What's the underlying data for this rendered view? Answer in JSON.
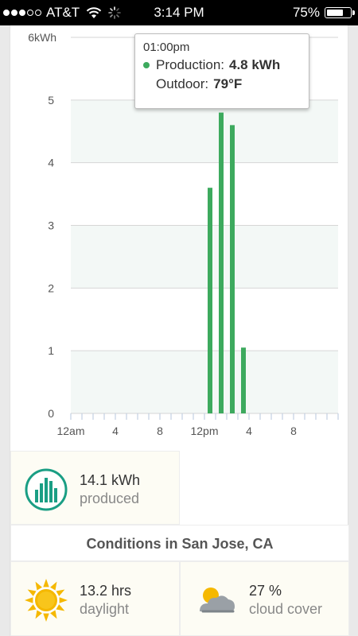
{
  "status_bar": {
    "carrier": "AT&T",
    "time": "3:14 PM",
    "battery_percent": "75%",
    "battery_level": 0.75,
    "signal_bars_filled": 3,
    "signal_bars_total": 5
  },
  "chart_data": {
    "type": "bar",
    "ylabel": "",
    "xlabel": "",
    "ylim": [
      0,
      6
    ],
    "y_ticks": [
      "0",
      "1",
      "2",
      "3",
      "4",
      "5",
      "6kWh"
    ],
    "x_tick_labels": [
      "12am",
      "4",
      "8",
      "12pm",
      "4",
      "8"
    ],
    "hours": [
      0,
      1,
      2,
      3,
      4,
      5,
      6,
      7,
      8,
      9,
      10,
      11,
      12,
      13,
      14,
      15,
      16,
      17,
      18,
      19,
      20,
      21,
      22,
      23
    ],
    "values": [
      0,
      0,
      0,
      0,
      0,
      0,
      0,
      0,
      0,
      0,
      0,
      0,
      3.6,
      4.8,
      4.6,
      1.05,
      0,
      0,
      0,
      0,
      0,
      0,
      0,
      0
    ],
    "bar_color": "#3daa5e",
    "band_color": "#f3f8f6",
    "grid": true,
    "tooltip": {
      "time": "01:00pm",
      "production_label": "Production:",
      "production_value": "4.8 kWh",
      "outdoor_label": "Outdoor:",
      "outdoor_value": "79°F"
    }
  },
  "summary": {
    "produced_value": "14.1 kWh",
    "produced_label": "produced",
    "conditions_title": "Conditions in San Jose, CA",
    "daylight_value": "13.2 hrs",
    "daylight_label": "daylight",
    "cloud_value": "27 %",
    "cloud_label": "cloud cover"
  },
  "icons": {
    "produced": "production-chart-icon",
    "daylight": "sun-icon",
    "cloud": "partly-cloudy-icon"
  },
  "colors": {
    "accent_green": "#3daa5e",
    "teal": "#1a9e84",
    "sun": "#f5b800"
  }
}
